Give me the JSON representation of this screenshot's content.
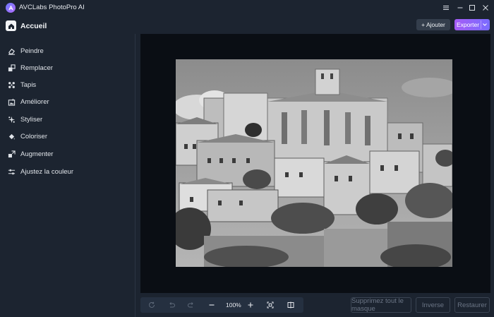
{
  "window": {
    "title": "AVCLabs PhotoPro AI",
    "controls": [
      "menu-icon",
      "minimize-icon",
      "maximize-icon",
      "close-icon"
    ]
  },
  "sidebar": {
    "home_label": "Accueil",
    "items": [
      {
        "label": "Peindre",
        "icon": "eraser-icon"
      },
      {
        "label": "Remplacer",
        "icon": "replace-icon"
      },
      {
        "label": "Tapis",
        "icon": "pattern-icon"
      },
      {
        "label": "Améliorer",
        "icon": "enhance-icon"
      },
      {
        "label": "Styliser",
        "icon": "style-icon"
      },
      {
        "label": "Coloriser",
        "icon": "paint-bucket-icon"
      },
      {
        "label": "Augmenter",
        "icon": "upscale-icon"
      },
      {
        "label": "Ajustez la couleur",
        "icon": "sliders-icon"
      }
    ]
  },
  "topbar": {
    "add_label": "+ Ajouter",
    "export_label": "Exporter"
  },
  "toolbar": {
    "zoom": "100%",
    "tools": [
      "refresh-icon",
      "undo-icon",
      "redo-icon",
      "zoom-out-icon",
      "zoom-in-icon",
      "fit-screen-icon",
      "compare-icon"
    ]
  },
  "actions": {
    "clear_mask": "Supprimez tout le masque",
    "inverse": "Inverse",
    "restore": "Restaurer"
  },
  "colors": {
    "background": "#1c2430",
    "canvas": "#0a0e14",
    "accent_gradient_start": "#a55cf6",
    "accent_gradient_end": "#7a6cff"
  }
}
